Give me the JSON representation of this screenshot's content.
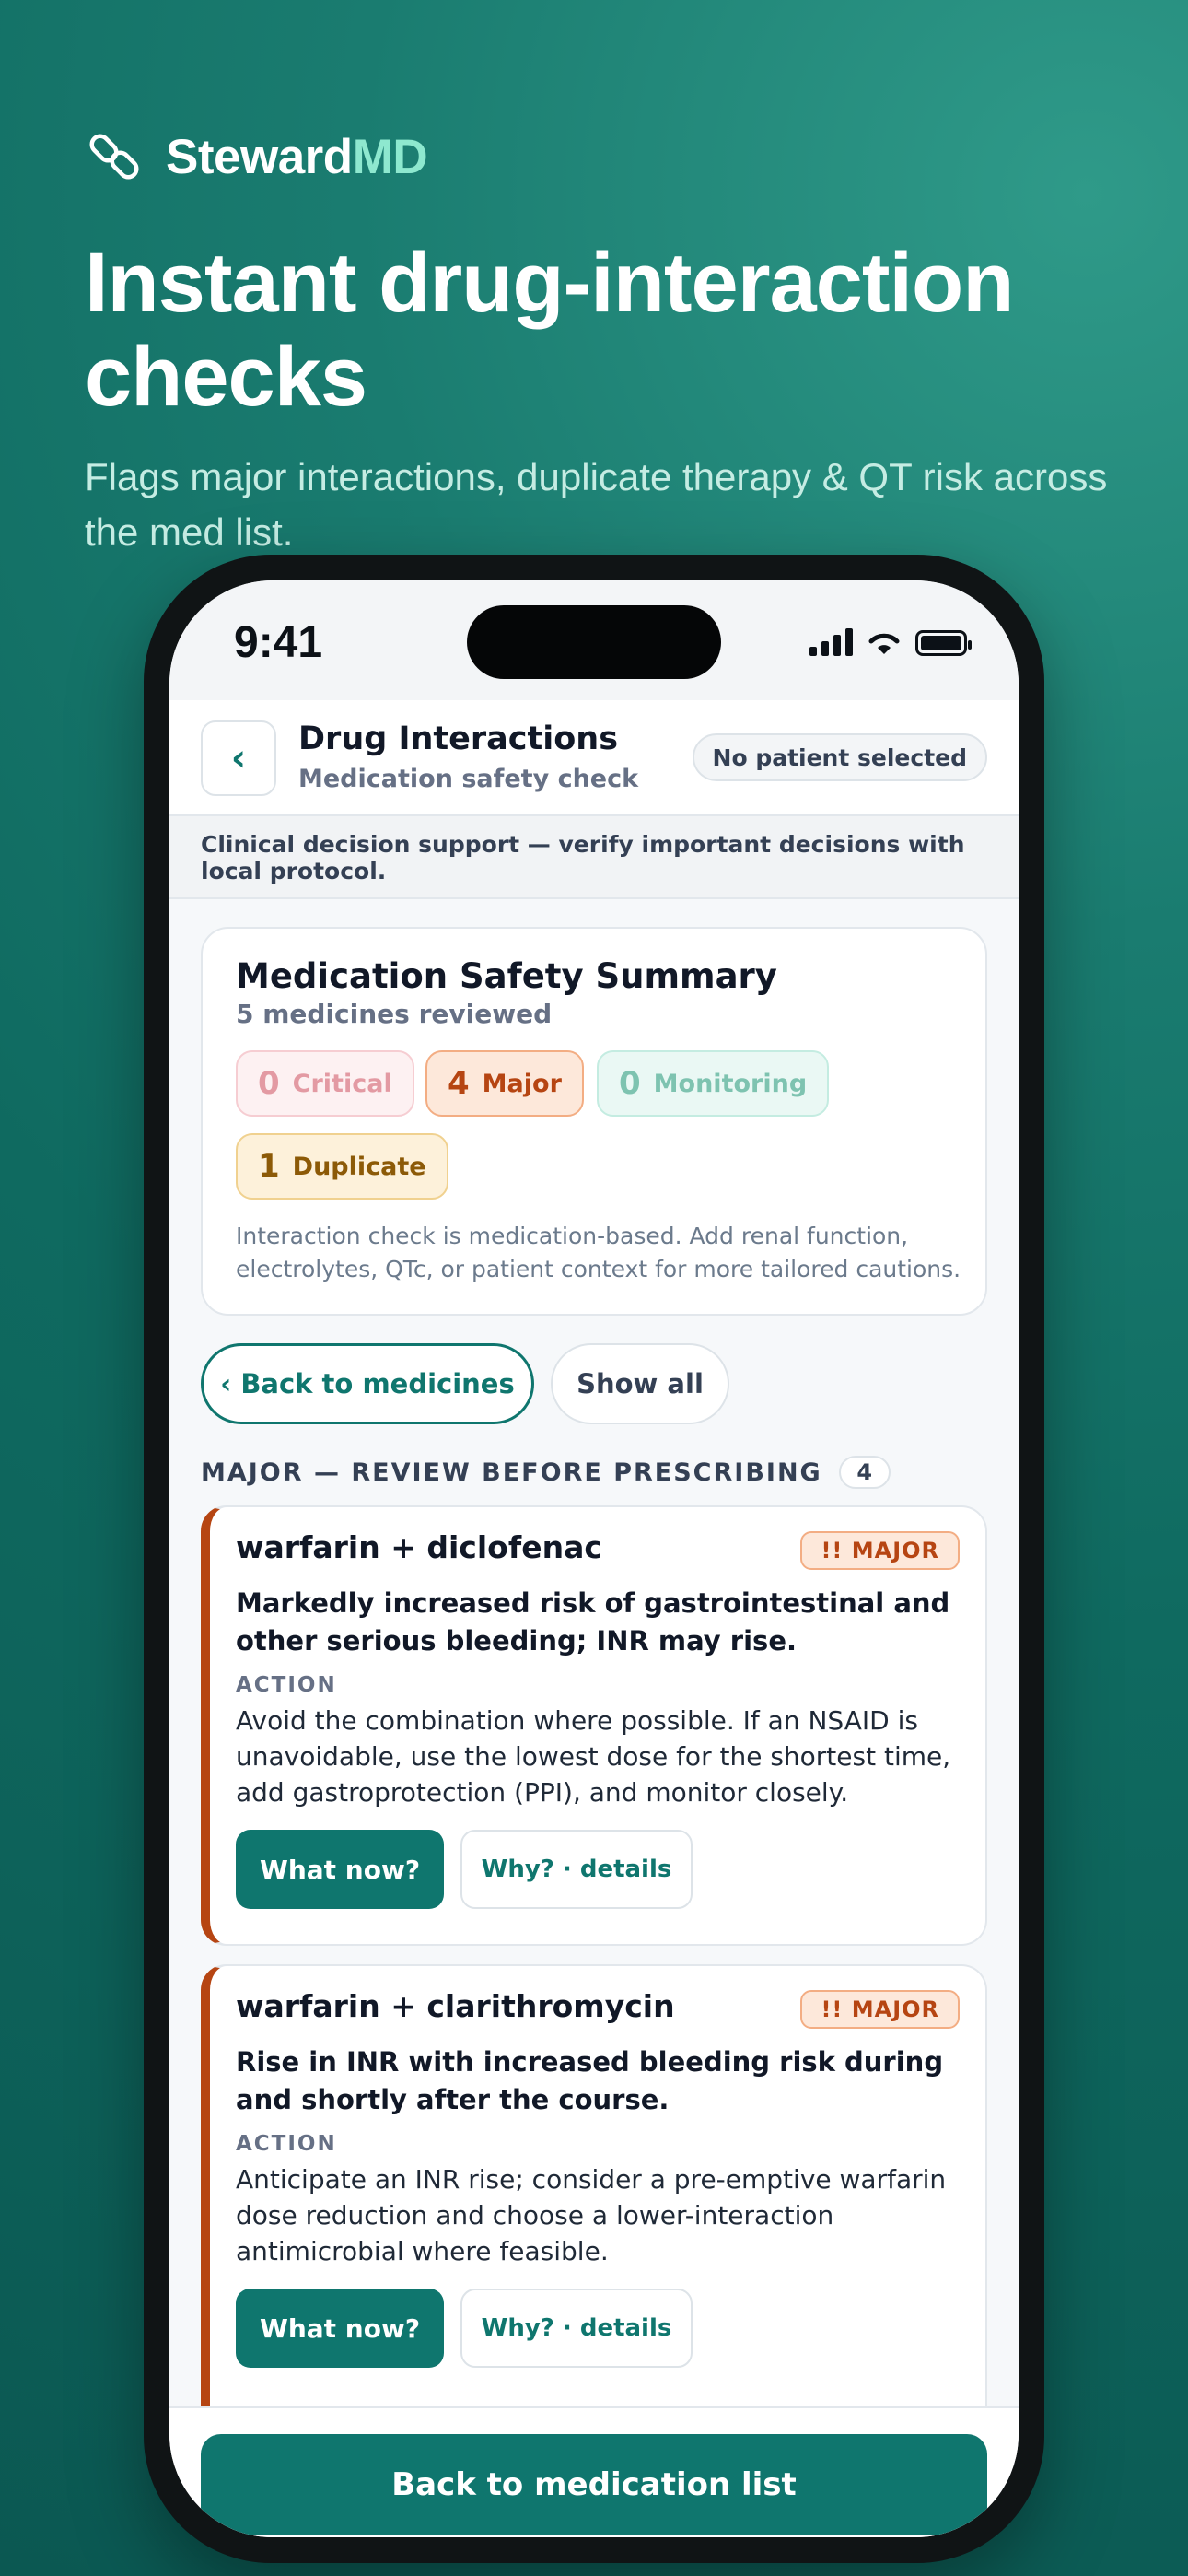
{
  "brand": {
    "name_main": "Steward",
    "name_accent": "MD",
    "logo_icon": "pill-link-icon"
  },
  "hero": {
    "headline": "Instant drug-interaction checks",
    "subhead": "Flags major interactions, duplicate therapy & QT risk across the med list."
  },
  "status_bar": {
    "time": "9:41",
    "icons": [
      "signal-icon",
      "wifi-icon",
      "battery-icon"
    ]
  },
  "header": {
    "back_icon": "chevron-left-icon",
    "back_glyph": "‹",
    "title": "Drug Interactions",
    "subtitle": "Medication safety check",
    "patient_status": "No patient selected"
  },
  "disclaimer": "Clinical decision support — verify important decisions with local protocol.",
  "summary": {
    "title": "Medication Safety Summary",
    "subtitle": "5 medicines reviewed",
    "chips": {
      "critical": {
        "count": "0",
        "label": "Critical"
      },
      "major": {
        "count": "4",
        "label": "Major"
      },
      "monitoring": {
        "count": "0",
        "label": "Monitoring"
      },
      "duplicate": {
        "count": "1",
        "label": "Duplicate"
      }
    },
    "note": "Interaction check is medication-based. Add renal function, electrolytes, QTc, or patient context for more tailored cautions."
  },
  "actions": {
    "back_to_medicines": "‹ Back to medicines",
    "show_all": "Show all"
  },
  "section": {
    "title": "MAJOR — REVIEW BEFORE PRESCRIBING",
    "count": "4"
  },
  "interactions": [
    {
      "pair": "warfarin + diclofenac",
      "badge": "!! MAJOR",
      "effect": "Markedly increased risk of gastrointestinal and other serious bleeding; INR may rise.",
      "action_label": "ACTION",
      "action": "Avoid the combination where possible. If an NSAID is unavoidable, use the lowest dose for the shortest time, add gastroprotection (PPI), and monitor closely.",
      "what_now": "What now?",
      "why": "Why? · details"
    },
    {
      "pair": "warfarin + clarithromycin",
      "badge": "!! MAJOR",
      "effect": "Rise in INR with increased bleeding risk during and shortly after the course.",
      "action_label": "ACTION",
      "action": "Anticipate an INR rise; consider a pre-emptive warfarin dose reduction and choose a lower-interaction antimicrobial where feasible.",
      "what_now": "What now?",
      "why": "Why? · details"
    }
  ],
  "footer": {
    "primary_button": "Back to medication list"
  },
  "colors": {
    "brand_teal": "#0f766e",
    "major": "#b64512",
    "accent_mint": "#8ee8cf"
  }
}
